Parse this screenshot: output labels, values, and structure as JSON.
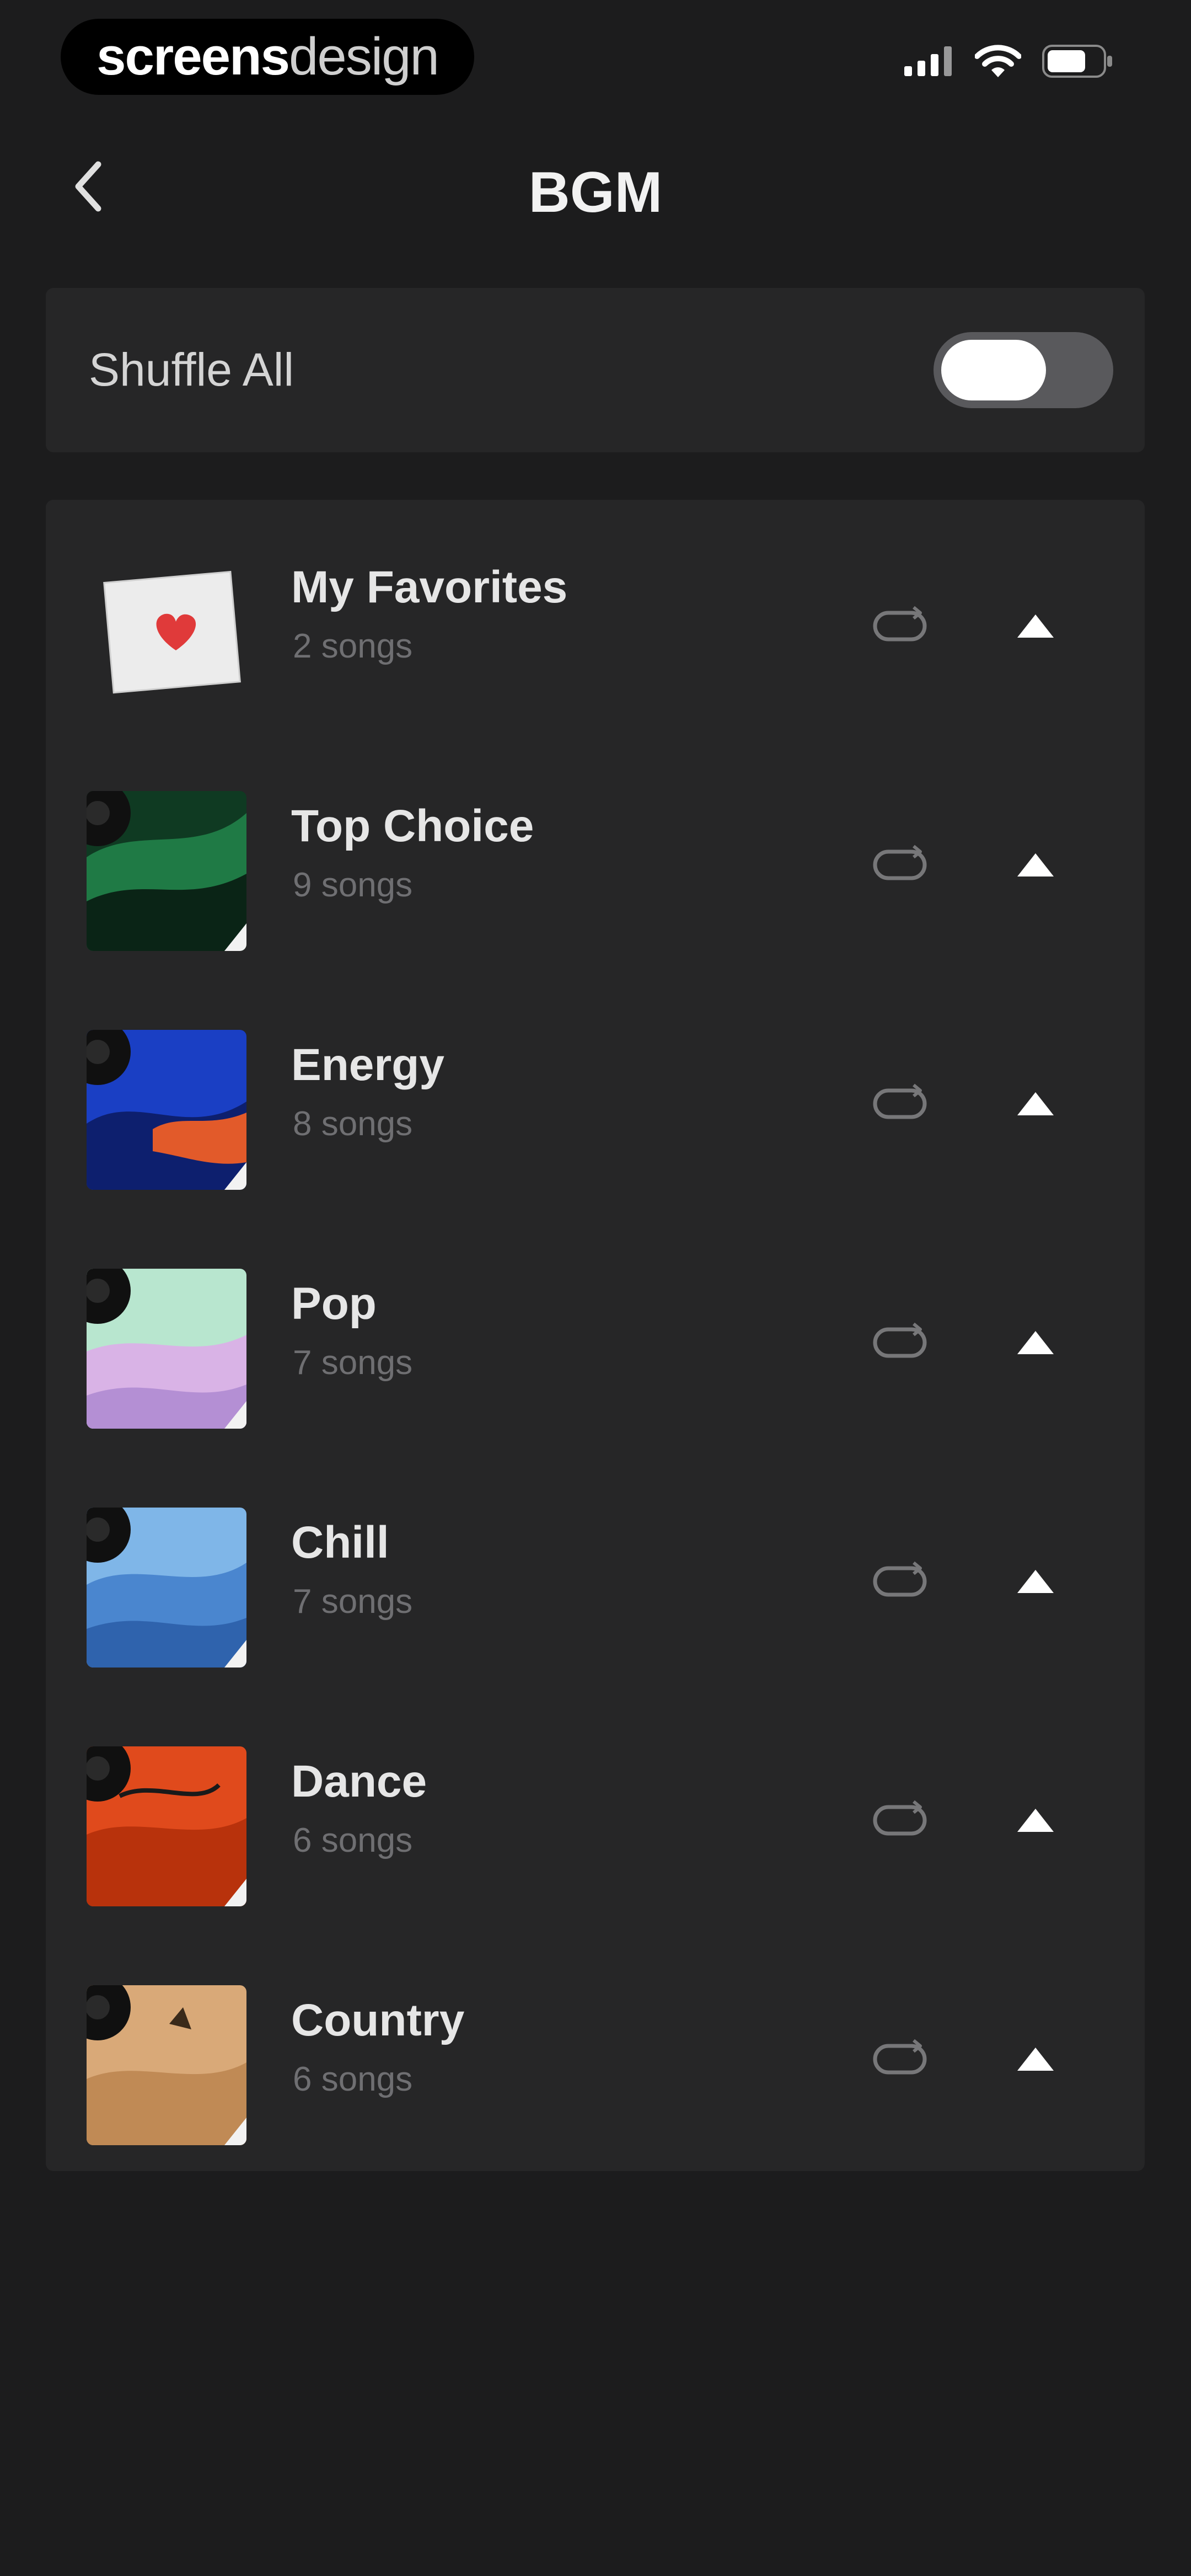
{
  "status_bar": {
    "brand_strong": "screens",
    "brand_light": "design",
    "icons": [
      "cellular-signal-icon",
      "wifi-icon",
      "battery-icon"
    ]
  },
  "header": {
    "title": "BGM",
    "back_icon": "chevron-left-icon"
  },
  "shuffle": {
    "label": "Shuffle All",
    "enabled": true
  },
  "playlists": [
    {
      "title": "My Favorites",
      "count": "2 songs",
      "cover": "favorites-heart"
    },
    {
      "title": "Top Choice",
      "count": "9 songs",
      "cover": "top-choice"
    },
    {
      "title": "Energy",
      "count": "8 songs",
      "cover": "energy"
    },
    {
      "title": "Pop",
      "count": "7 songs",
      "cover": "pop"
    },
    {
      "title": "Chill",
      "count": "7 songs",
      "cover": "chill"
    },
    {
      "title": "Dance",
      "count": "6 songs",
      "cover": "dance"
    },
    {
      "title": "Country",
      "count": "6 songs",
      "cover": "country"
    }
  ],
  "colors": {
    "background": "#1c1c1d",
    "card": "#262627",
    "toggle_track": "#59595c",
    "secondary_text": "#6f6f72"
  }
}
